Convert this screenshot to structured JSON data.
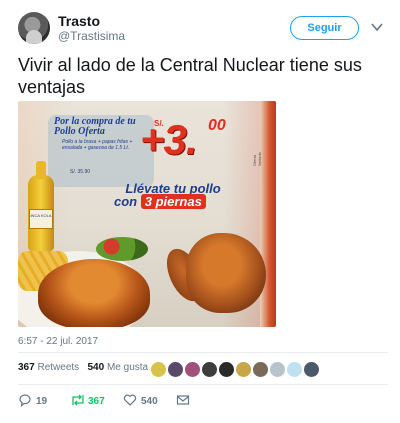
{
  "tweet": {
    "author_name": "Trasto",
    "author_handle": "@Trastisima",
    "follow_label": "Seguir",
    "text": "Vivir al lado de la Central Nuclear tiene sus ventajas",
    "timestamp": "6:57 - 22 jul. 2017"
  },
  "image_text": {
    "promo_line": "Por la compra de tu Pollo Oferta",
    "promo_small": "Pollo a la brasa + papas fritas + ensalada + gaseosa de 1.5 Lt.",
    "price_prefix": "S/.",
    "price_main": "+3.",
    "price_cents": "00",
    "old_price": "S/. 35.90",
    "headline_1": "Llévate tu pollo",
    "headline_2a": "con ",
    "headline_2b": "3 piernas",
    "vertical_note": "Oferta limitada",
    "bottle_label": "INCA KOLA"
  },
  "stats": {
    "retweets_count": "367",
    "retweets_label": "Retweets",
    "likes_count": "540",
    "likes_label": "Me gusta"
  },
  "actions": {
    "replies": "19",
    "retweets": "367",
    "likes": "540"
  },
  "colors": {
    "accent": "#1da1f2",
    "retweet_green": "#17bf63",
    "text_primary": "#14171a",
    "text_secondary": "#657786"
  }
}
